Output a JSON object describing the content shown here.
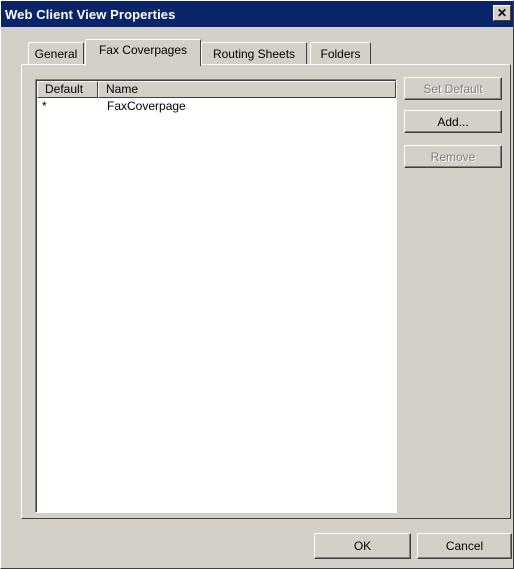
{
  "window": {
    "title": "Web Client View Properties",
    "close_label": "✕"
  },
  "tabs": [
    {
      "label": "General",
      "active": false
    },
    {
      "label": "Fax Coverpages",
      "active": true
    },
    {
      "label": "Routing Sheets",
      "active": false
    },
    {
      "label": "Folders",
      "active": false
    }
  ],
  "list": {
    "columns": [
      "Default",
      "Name"
    ],
    "rows": [
      {
        "default": "*",
        "name": "FaxCoverpage"
      }
    ]
  },
  "side_buttons": {
    "set_default": "Set Default",
    "add": "Add...",
    "remove": "Remove"
  },
  "footer": {
    "ok": "OK",
    "cancel": "Cancel"
  },
  "colors": {
    "titlebar": "#0a246a",
    "face": "#d4d0c8",
    "disabled_text": "#808080"
  }
}
